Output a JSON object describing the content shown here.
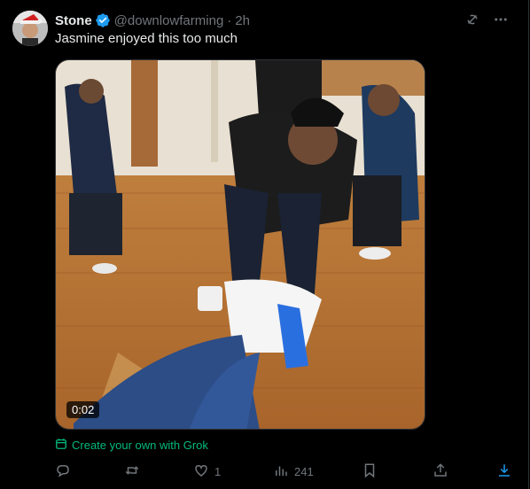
{
  "post": {
    "author_name": "Stone",
    "handle": "@downlowfarming",
    "separator": "·",
    "time": "2h",
    "text": "Jasmine enjoyed this too much"
  },
  "media": {
    "duration": "0:02"
  },
  "grok_link": "Create your own with Grok",
  "actions": {
    "replies": "",
    "reposts": "",
    "likes": "1",
    "views": "241"
  },
  "colors": {
    "background": "#000000",
    "text": "#e7e9ea",
    "muted": "#71767b",
    "verified": "#1d9bf0",
    "grok_green": "#00ba7c"
  },
  "icons": [
    "verified-icon",
    "grok-icon",
    "more-icon",
    "reply-icon",
    "repost-icon",
    "like-icon",
    "views-icon",
    "bookmark-icon",
    "share-icon",
    "download-icon"
  ]
}
